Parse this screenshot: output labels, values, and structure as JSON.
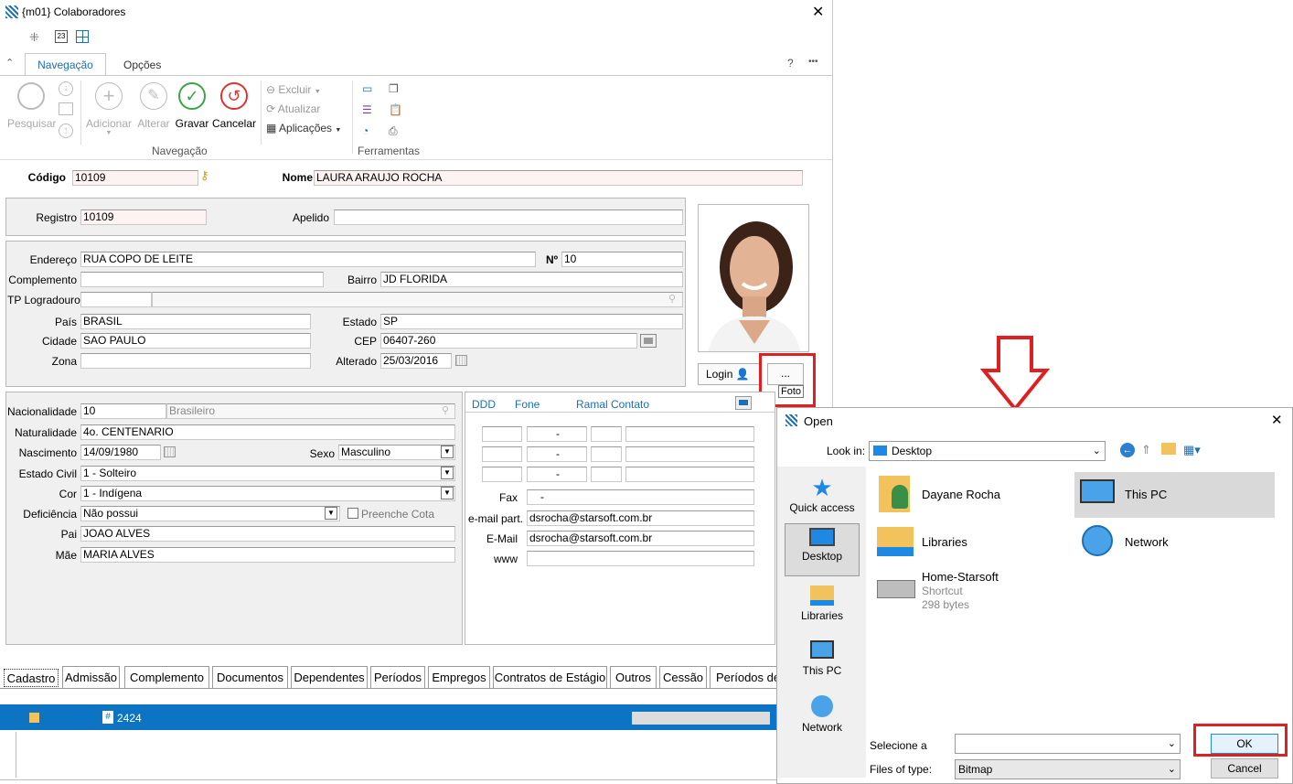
{
  "window": {
    "title": "{m01}  Colaboradores"
  },
  "ribbon": {
    "tabs": [
      "Navegação",
      "Opções"
    ],
    "help": "?",
    "more": "•••",
    "buttons": {
      "pesquisar": "Pesquisar",
      "adicionar": "Adicionar",
      "alterar": "Alterar",
      "gravar": "Gravar",
      "cancelar": "Cancelar",
      "excluir": "Excluir",
      "atualizar": "Atualizar",
      "aplicacoes": "Aplicações"
    },
    "groups": {
      "navegacao": "Navegação",
      "ferramentas": "Ferramentas"
    }
  },
  "header": {
    "codigo_label": "Código",
    "codigo": "10109",
    "nome_label": "Nome",
    "nome": "LAURA ARAUJO ROCHA"
  },
  "registro": {
    "registro_label": "Registro",
    "registro": "10109",
    "apelido_label": "Apelido",
    "apelido": ""
  },
  "address": {
    "endereco_label": "Endereço",
    "endereco": "RUA COPO DE LEITE",
    "numero_label": "Nº",
    "numero": "10",
    "complemento_label": "Complemento",
    "complemento": "",
    "bairro_label": "Bairro",
    "bairro": "JD FLORIDA",
    "tp_label": "TP Logradouro",
    "tp": "",
    "pais_label": "País",
    "pais": "BRASIL",
    "estado_label": "Estado",
    "estado": "SP",
    "cidade_label": "Cidade",
    "cidade": "SAO PAULO",
    "cep_label": "CEP",
    "cep": "06407-260",
    "zona_label": "Zona",
    "zona": "",
    "alterado_label": "Alterado",
    "alterado": "25/03/2016"
  },
  "photo": {
    "login_label": "Login",
    "foto_button": "...",
    "tooltip": "Foto"
  },
  "personal": {
    "nacionalidade_label": "Nacionalidade",
    "nacionalidade": "10",
    "nacionalidade_desc": "Brasileiro",
    "naturalidade_label": "Naturalidade",
    "naturalidade": "4o. CENTENARIO",
    "nascimento_label": "Nascimento",
    "nascimento": "14/09/1980",
    "sexo_label": "Sexo",
    "sexo": "Masculino",
    "estado_civil_label": "Estado Civil",
    "estado_civil": "1 - Solteiro",
    "cor_label": "Cor",
    "cor": "1 - Indígena",
    "deficiencia_label": "Deficiência",
    "deficiencia": "Não possui",
    "preenche_cota": "Preenche Cota",
    "pai_label": "Pai",
    "pai": "JOAO ALVES",
    "mae_label": "Mãe",
    "mae": "MARIA ALVES"
  },
  "contact": {
    "headers": [
      "DDD",
      "Fone",
      "Ramal",
      "Contato"
    ],
    "phone_sep": "-",
    "fax_label": "Fax",
    "fax": "-",
    "email_part_label": "e-mail part.",
    "email_part": "dsrocha@starsoft.com.br",
    "email_label": "E-Mail",
    "email": "dsrocha@starsoft.com.br",
    "www_label": "www",
    "www": ""
  },
  "bottom_tabs": [
    "Cadastro",
    "Admissão",
    "Complemento",
    "Documentos",
    "Dependentes",
    "Períodos",
    "Empregos",
    "Contratos de Estágio",
    "Outros",
    "Cessão",
    "Períodos de"
  ],
  "status": {
    "count_icon": "#",
    "count": "2424"
  },
  "open_dialog": {
    "title": "Open",
    "look_in_label": "Look in:",
    "look_in": "Desktop",
    "nav": [
      "Quick access",
      "Desktop",
      "Libraries",
      "This PC",
      "Network"
    ],
    "items": [
      {
        "name": "Dayane Rocha"
      },
      {
        "name": "This PC"
      },
      {
        "name": "Libraries"
      },
      {
        "name": "Network"
      },
      {
        "name": "Home-Starsoft",
        "line2": "Shortcut",
        "line3": "298 bytes"
      }
    ],
    "filename_label": "Selecione a",
    "filename": "",
    "filetype_label": "Files of type:",
    "filetype": "Bitmap",
    "ok": "OK",
    "cancel": "Cancel"
  }
}
